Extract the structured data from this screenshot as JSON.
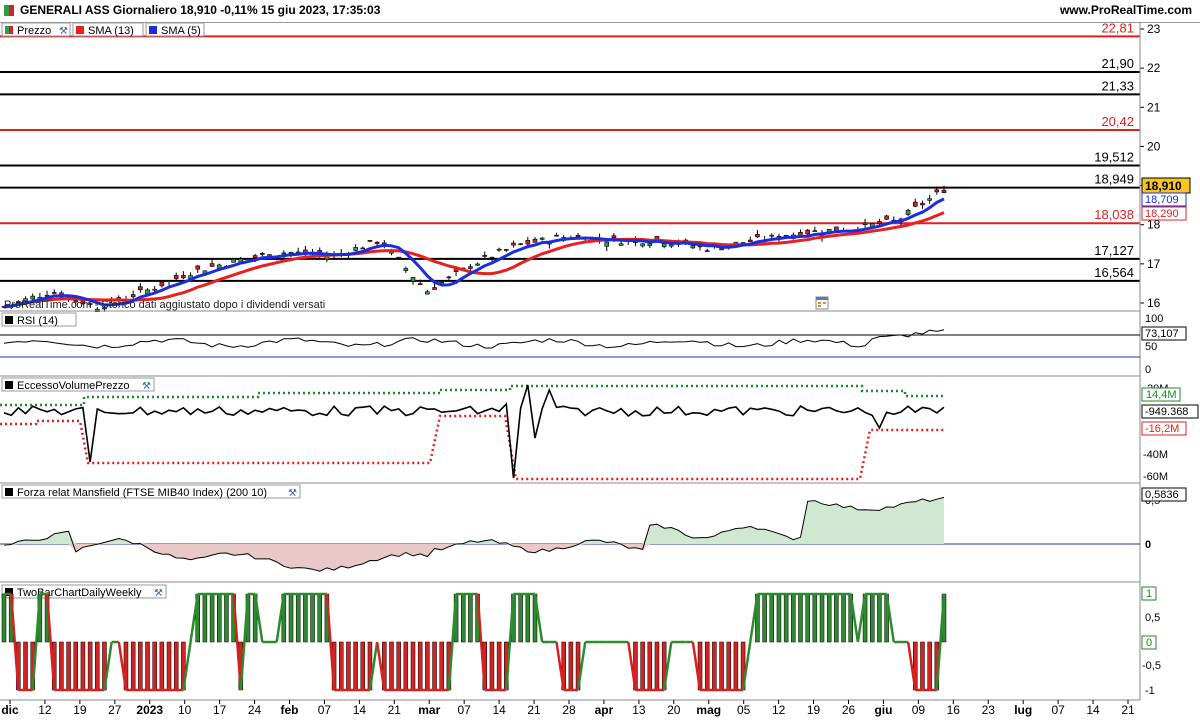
{
  "header": {
    "title": "GENERALI ASS Giornaliero 18,910 -0,11% 15 giu 2023, 17:35:03",
    "site": "www.ProRealTime.com"
  },
  "price_panel": {
    "legend": [
      "Prezzo",
      "SMA (13)",
      "SMA (5)"
    ],
    "watermark": "ProRealTime.com - Storico dati aggiustato dopo i dividendi versati",
    "axis_ticks": [
      "16",
      "17",
      "18",
      "19",
      "20",
      "21",
      "22",
      "23"
    ],
    "levels": [
      {
        "label": "22,81",
        "value": 22.81,
        "color": "#e02020"
      },
      {
        "label": "21,90",
        "value": 21.9,
        "color": "#000000"
      },
      {
        "label": "21,33",
        "value": 21.33,
        "color": "#000000"
      },
      {
        "label": "20,42",
        "value": 20.42,
        "color": "#e02020"
      },
      {
        "label": "19,512",
        "value": 19.512,
        "color": "#000000"
      },
      {
        "label": "18,949",
        "value": 18.949,
        "color": "#000000"
      },
      {
        "label": "18,038",
        "value": 18.038,
        "color": "#e02020"
      },
      {
        "label": "17,127",
        "value": 17.127,
        "color": "#000000"
      },
      {
        "label": "16,564",
        "value": 16.564,
        "color": "#000000"
      }
    ],
    "badges": {
      "price": "18,910",
      "sma5": "18,709",
      "sma13": "18,290"
    },
    "colors": {
      "up": "#2e9e3e",
      "down": "#d22222",
      "sma13": "#e82020",
      "sma5": "#1a2ee0"
    }
  },
  "rsi_panel": {
    "label": "RSI (14)",
    "axis_ticks": [
      "100",
      "50",
      "0"
    ],
    "badge": "73,107"
  },
  "volume_panel": {
    "label": "EccessoVolumePrezzo",
    "axis_ticks": [
      "20M",
      "-40M",
      "-60M"
    ],
    "badges": {
      "upper": "14,4M",
      "value": "-949.368",
      "lower": "-16,2M"
    }
  },
  "mansfield_panel": {
    "label": "Forza relat Mansfield (FTSE MIB40 Index) (200 10)",
    "axis_ticks": [
      "0,5",
      "0"
    ],
    "badge": "0,5836"
  },
  "twobar_panel": {
    "label": "TwoBarChartDailyWeekly",
    "axis_ticks": [
      "1",
      "0,5",
      "0",
      "-0,5",
      "-1"
    ],
    "badges": {
      "top": "1",
      "zero": "0"
    }
  },
  "x_axis": {
    "labels": [
      "dic",
      "12",
      "19",
      "27",
      "2023",
      "10",
      "17",
      "24",
      "feb",
      "07",
      "14",
      "21",
      "mar",
      "07",
      "14",
      "21",
      "28",
      "apr",
      "13",
      "20",
      "mag",
      "05",
      "12",
      "19",
      "26",
      "giu",
      "09",
      "16",
      "23",
      "lug",
      "07",
      "14",
      "21"
    ]
  },
  "chart_data": [
    {
      "type": "candlestick",
      "title": "GENERALI ASS Giornaliero",
      "ylim": [
        15.8,
        23.1
      ],
      "x": [
        "dic",
        "2023",
        "feb",
        "mar",
        "apr",
        "mag",
        "giu"
      ],
      "series": [
        {
          "name": "Prezzo",
          "values": [
            15.9,
            16.3,
            15.9,
            16.3,
            16.8,
            17.1,
            17.3,
            17.2,
            17.6,
            16.3,
            17.0,
            17.5,
            17.7,
            17.6,
            17.6,
            17.4,
            17.6,
            17.8,
            17.9,
            18.1,
            18.9
          ]
        },
        {
          "name": "SMA (13)",
          "values": [
            15.8,
            16.0,
            15.9,
            16.1,
            16.5,
            16.9,
            17.1,
            17.2,
            17.3,
            16.8,
            17.0,
            17.3,
            17.5,
            17.6,
            17.5,
            17.5,
            17.6,
            17.7,
            17.8,
            18.0,
            18.3
          ]
        },
        {
          "name": "SMA (5)",
          "values": [
            15.9,
            16.2,
            15.9,
            16.2,
            16.7,
            17.0,
            17.2,
            17.2,
            17.5,
            16.6,
            17.0,
            17.4,
            17.7,
            17.6,
            17.5,
            17.5,
            17.6,
            17.8,
            17.9,
            18.2,
            18.7
          ]
        }
      ],
      "last": {
        "price": 18.91,
        "sma5": 18.709,
        "sma13": 18.29
      }
    },
    {
      "type": "line",
      "title": "RSI (14)",
      "ylim": [
        0,
        100
      ],
      "last": 73.107
    },
    {
      "type": "line",
      "title": "EccessoVolumePrezzo",
      "last": -949368,
      "upper": 14.4,
      "lower": -16.2
    },
    {
      "type": "area",
      "title": "Forza relat Mansfield (FTSE MIB40 Index) (200 10)",
      "last": 0.5836
    },
    {
      "type": "line",
      "title": "TwoBarChartDailyWeekly",
      "ylim": [
        -1,
        1
      ]
    }
  ]
}
